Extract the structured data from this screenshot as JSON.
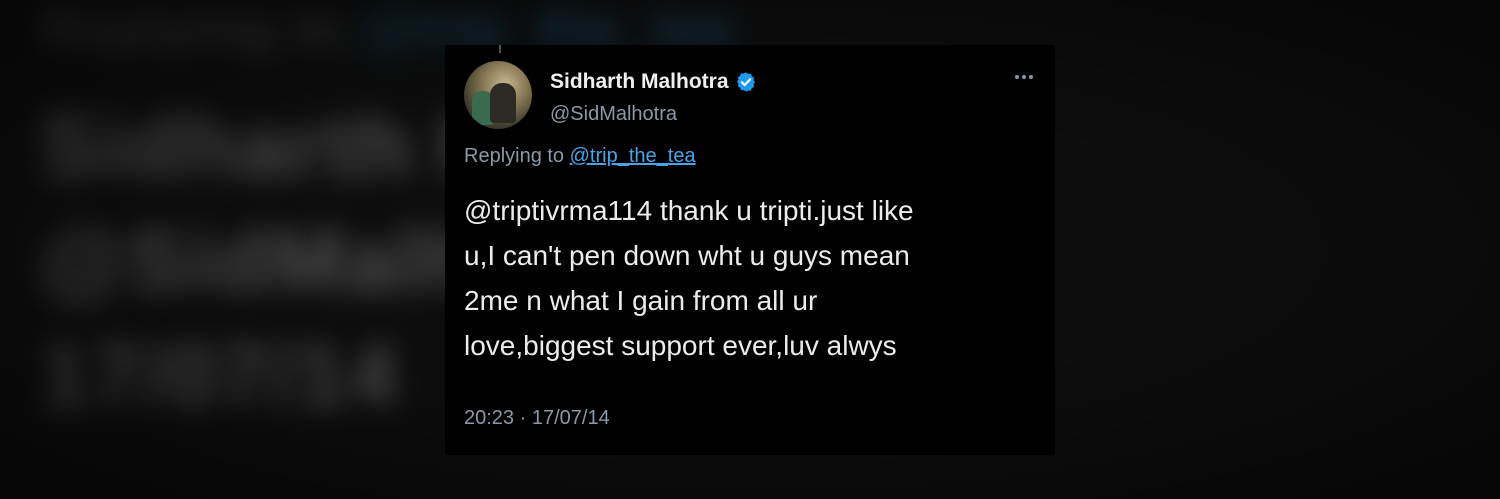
{
  "tweet": {
    "author_name": "Sidharth Malhotra",
    "author_handle": "@SidMalhotra",
    "replying_prefix": "Replying to",
    "replying_to": "@trip_the_tea",
    "text": "@triptivrma114 thank u tripti.just like\nu,I can't pen down wht u guys mean\n2me n what I gain from all ur\nlove,biggest support ever,luv alwys",
    "time": "20:23",
    "separator": "·",
    "date": "17/07/14"
  },
  "icons": {
    "verified": "verified-badge-icon",
    "more": "more-options-icon"
  },
  "colors": {
    "card_bg": "#000000",
    "link": "#4aa3e8",
    "verified": "#1d9bf0",
    "muted": "#8b98a5"
  }
}
